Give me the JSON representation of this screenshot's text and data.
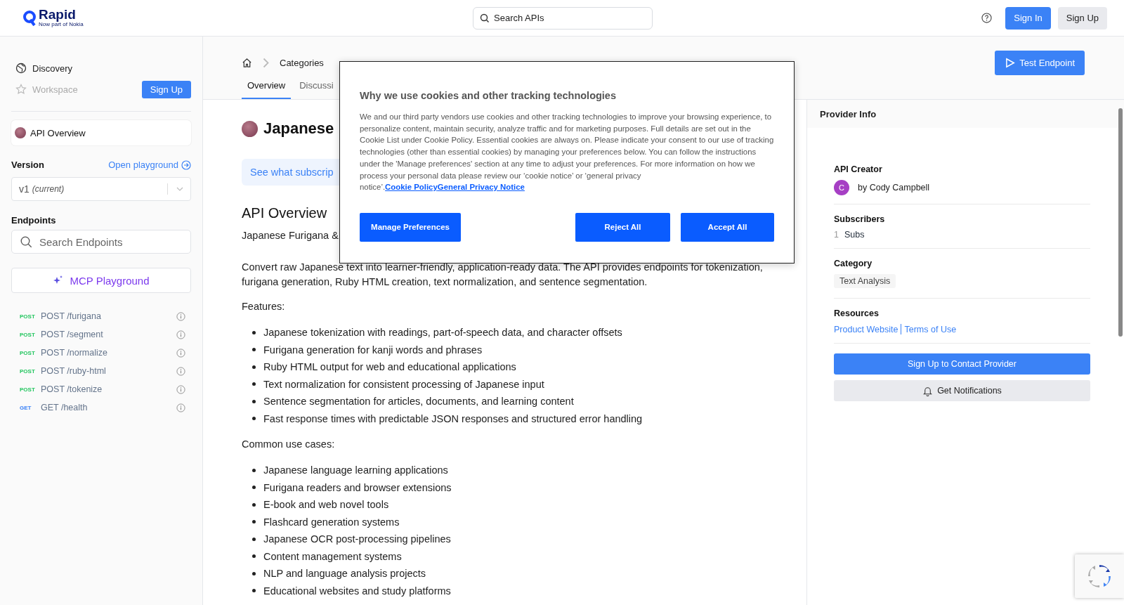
{
  "header": {
    "logo": {
      "name": "Rapid",
      "tagline": "Now part of Nokia"
    },
    "search": {
      "placeholder": "Search APIs"
    },
    "sign_in": "Sign In",
    "sign_up": "Sign Up"
  },
  "sidebar": {
    "nav": [
      {
        "label": "Discovery",
        "disabled": false
      },
      {
        "label": "Workspace",
        "disabled": true
      }
    ],
    "sign_up": "Sign Up",
    "api_overview": {
      "label": "API Overview",
      "selected": true
    },
    "version_label": "Version",
    "open_playground": "Open playground",
    "version_select": {
      "value": "v1",
      "note": "(current)"
    },
    "endpoints_label": "Endpoints",
    "endpoint_search": {
      "placeholder": "Search Endpoints"
    },
    "mcp_button": "MCP Playground",
    "endpoints": [
      {
        "kind": "post",
        "method": "POST",
        "path": "POST /furigana"
      },
      {
        "kind": "post",
        "method": "POST",
        "path": "POST /segment"
      },
      {
        "kind": "post",
        "method": "POST",
        "path": "POST /normalize"
      },
      {
        "kind": "post",
        "method": "POST",
        "path": "POST /ruby-html"
      },
      {
        "kind": "post",
        "method": "POST",
        "path": "POST /tokenize"
      },
      {
        "kind": "get",
        "method": "GET",
        "path": "GET /health"
      }
    ]
  },
  "main": {
    "breadcrumb": [
      "Categories"
    ],
    "tabs": [
      {
        "label": "Overview",
        "selected": true
      },
      {
        "label": "Discussi",
        "selected": false
      }
    ],
    "test_endpoint": "Test Endpoint",
    "title": "Japanese",
    "banner": "See what subscrip",
    "overview_heading": "API Overview",
    "subtitle": "Japanese Furigana &",
    "description": "Convert raw Japanese text into learner-friendly, application-ready data. The API provides endpoints for tokenization, furigana generation, Ruby HTML creation, text normalization, and sentence segmentation.",
    "features_label": "Features:",
    "features": [
      "Japanese tokenization with readings, part-of-speech data, and character offsets",
      "Furigana generation for kanji words and phrases",
      "Ruby HTML output for web and educational applications",
      "Text normalization for consistent processing of Japanese input",
      "Sentence segmentation for articles, documents, and learning content",
      "Fast response times with predictable JSON responses and structured error handling"
    ],
    "use_cases_label": "Common use cases:",
    "use_cases": [
      "Japanese language learning applications",
      "Furigana readers and browser extensions",
      "E-book and web novel tools",
      "Flashcard generation systems",
      "Japanese OCR post-processing pipelines",
      "Content management systems",
      "NLP and language analysis projects",
      "Educational websites and study platforms"
    ]
  },
  "provider": {
    "title": "Provider Info",
    "creator_label": "API Creator",
    "avatar_letter": "C",
    "creator": "by Cody Campbell",
    "subscribers_label": "Subscribers",
    "subscriber_count": "1",
    "subscriber_unit": "Subs",
    "category_label": "Category",
    "category": "Text Analysis",
    "resources_label": "Resources",
    "links": [
      "Product Website",
      "Terms of Use"
    ],
    "contact_button": "Sign Up to Contact Provider",
    "notify_button": "Get Notifications"
  },
  "cookie_dialog": {
    "title": "Why we use cookies and other tracking technologies",
    "body": "We and our third party vendors use cookies and other tracking technologies to improve your browsing experience, to personalize content, maintain security, analyze traffic and for marketing purposes. Full details are set out in the Cookie List under Cookie Policy. Essential cookies are always on. Please indicate your consent to our use of tracking technologies (other than essential cookies) by managing your preferences below. You can follow the instructions under the 'Manage preferences' section at any time to adjust your preferences. For more information on how we process your personal data please review our ‘cookie notice’ or ‘general privacy notice’.",
    "links": [
      "Cookie Policy",
      "General Privacy Notice"
    ],
    "manage": "Manage Preferences",
    "reject": "Reject All",
    "accept": "Accept All"
  }
}
